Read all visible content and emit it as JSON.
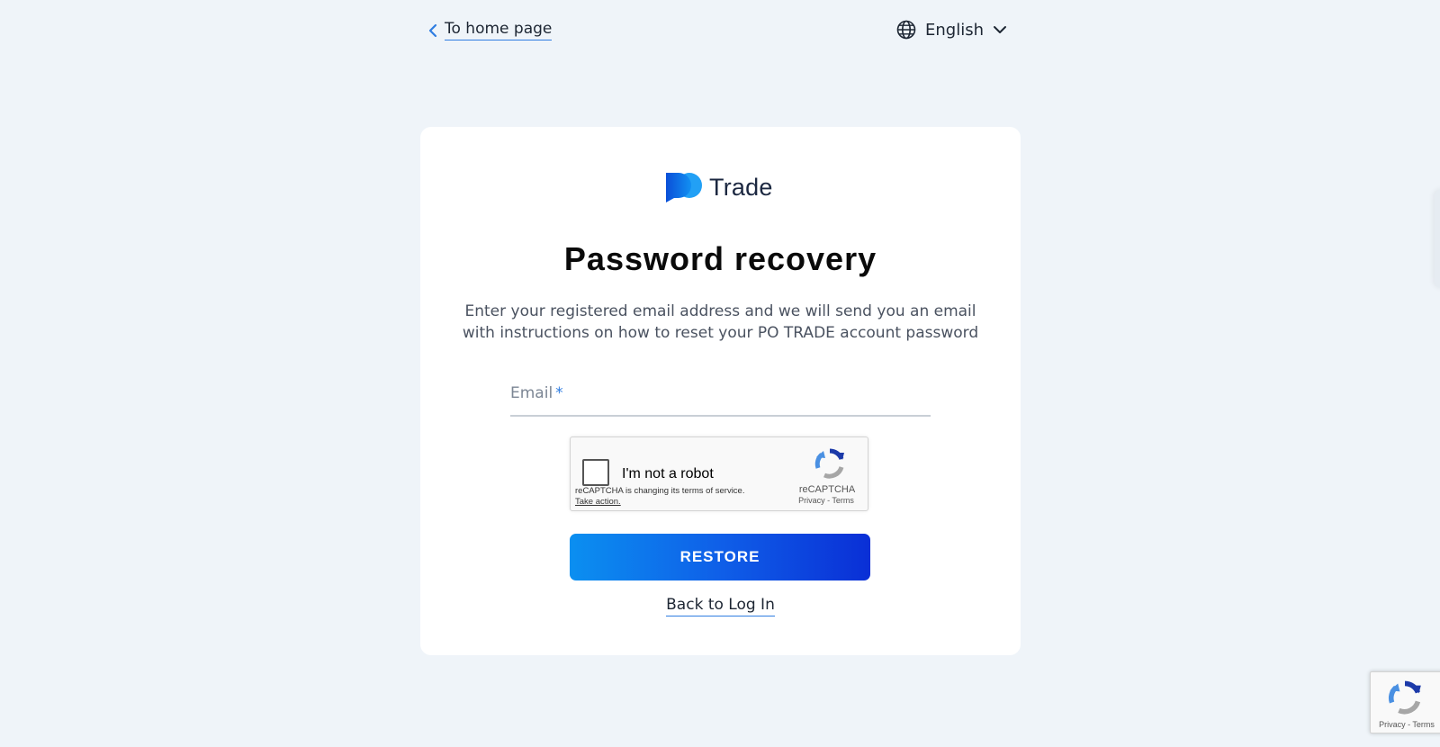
{
  "topbar": {
    "home_link": "To home page",
    "language": "English",
    "home_icon": "chevron-left-icon",
    "language_icon": "globe-icon",
    "language_caret": "chevron-down-icon"
  },
  "logo": {
    "brand": "Trade",
    "mark": "po-trade-logo"
  },
  "form": {
    "title": "Password recovery",
    "description": "Enter your registered email address and we will send you an email with instructions on how to reset your PO TRADE account password",
    "email_label": "Email",
    "email_required_marker": "*",
    "email_value": "",
    "restore_label": "RESTORE",
    "back_label": "Back to Log In"
  },
  "captcha": {
    "checkbox_label": "I'm not a robot",
    "notice": "reCAPTCHA is changing its terms of service.",
    "notice_action": "Take action.",
    "brand": "reCAPTCHA",
    "links": "Privacy - Terms"
  },
  "badge": {
    "links": "Privacy - Terms"
  },
  "colors": {
    "page_bg": "#eff4f9",
    "card_bg": "#ffffff",
    "accent": "#2f7de1",
    "button_start": "#0b8ff0",
    "button_end": "#0a2fd6",
    "title": "#0a0a0a"
  }
}
